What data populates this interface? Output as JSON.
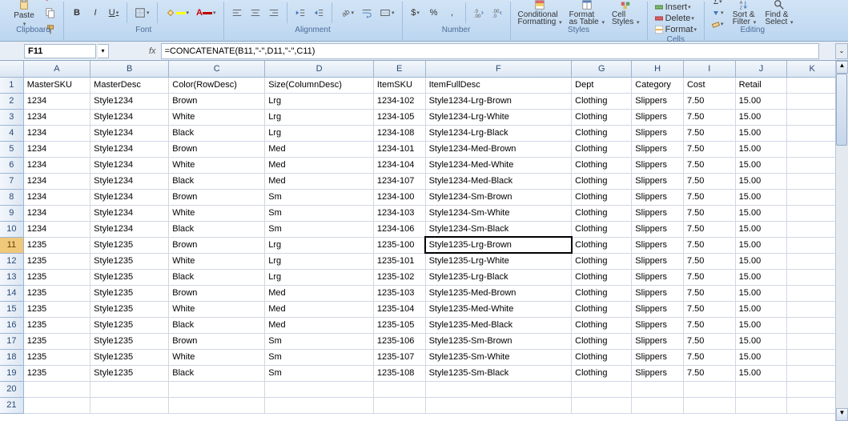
{
  "ribbon": {
    "groups": {
      "clipboard": {
        "label": "Clipboard",
        "paste": "Paste"
      },
      "font": {
        "label": "Font",
        "bold": "B",
        "italic": "I",
        "underline": "U"
      },
      "alignment": {
        "label": "Alignment"
      },
      "number": {
        "label": "Number",
        "currency": "$",
        "percent": "%",
        "comma": ","
      },
      "styles": {
        "label": "Styles",
        "conditional": "Conditional",
        "conditional2": "Formatting",
        "format_table": "Format",
        "format_table2": "as Table",
        "cell_styles": "Cell",
        "cell_styles2": "Styles"
      },
      "cells": {
        "label": "Cells",
        "insert": "Insert",
        "delete": "Delete",
        "format": "Format"
      },
      "editing": {
        "label": "Editing",
        "sort_filter": "Sort &",
        "sort_filter2": "Filter",
        "find_select": "Find &",
        "find_select2": "Select"
      }
    }
  },
  "namebox": "F11",
  "formula": "=CONCATENATE(B11,\"-\",D11,\"-\",C11)",
  "chart_data": {
    "type": "table",
    "columns": [
      "MasterSKU",
      "MasterDesc",
      "Color(RowDesc)",
      "Size(ColumnDesc)",
      "ItemSKU",
      "ItemFullDesc",
      "Dept",
      "Category",
      "Cost",
      "Retail"
    ],
    "rows": [
      {
        "MasterSKU": "1234",
        "MasterDesc": "Style1234",
        "Color": "Brown",
        "Size": "Lrg",
        "ItemSKU": "1234-102",
        "ItemFullDesc": "Style1234-Lrg-Brown",
        "Dept": "Clothing",
        "Category": "Slippers",
        "Cost": "7.50",
        "Retail": "15.00"
      },
      {
        "MasterSKU": "1234",
        "MasterDesc": "Style1234",
        "Color": "White",
        "Size": "Lrg",
        "ItemSKU": "1234-105",
        "ItemFullDesc": "Style1234-Lrg-White",
        "Dept": "Clothing",
        "Category": "Slippers",
        "Cost": "7.50",
        "Retail": "15.00"
      },
      {
        "MasterSKU": "1234",
        "MasterDesc": "Style1234",
        "Color": "Black",
        "Size": "Lrg",
        "ItemSKU": "1234-108",
        "ItemFullDesc": "Style1234-Lrg-Black",
        "Dept": "Clothing",
        "Category": "Slippers",
        "Cost": "7.50",
        "Retail": "15.00"
      },
      {
        "MasterSKU": "1234",
        "MasterDesc": "Style1234",
        "Color": "Brown",
        "Size": "Med",
        "ItemSKU": "1234-101",
        "ItemFullDesc": "Style1234-Med-Brown",
        "Dept": "Clothing",
        "Category": "Slippers",
        "Cost": "7.50",
        "Retail": "15.00"
      },
      {
        "MasterSKU": "1234",
        "MasterDesc": "Style1234",
        "Color": "White",
        "Size": "Med",
        "ItemSKU": "1234-104",
        "ItemFullDesc": "Style1234-Med-White",
        "Dept": "Clothing",
        "Category": "Slippers",
        "Cost": "7.50",
        "Retail": "15.00"
      },
      {
        "MasterSKU": "1234",
        "MasterDesc": "Style1234",
        "Color": "Black",
        "Size": "Med",
        "ItemSKU": "1234-107",
        "ItemFullDesc": "Style1234-Med-Black",
        "Dept": "Clothing",
        "Category": "Slippers",
        "Cost": "7.50",
        "Retail": "15.00"
      },
      {
        "MasterSKU": "1234",
        "MasterDesc": "Style1234",
        "Color": "Brown",
        "Size": "Sm",
        "ItemSKU": "1234-100",
        "ItemFullDesc": "Style1234-Sm-Brown",
        "Dept": "Clothing",
        "Category": "Slippers",
        "Cost": "7.50",
        "Retail": "15.00"
      },
      {
        "MasterSKU": "1234",
        "MasterDesc": "Style1234",
        "Color": "White",
        "Size": "Sm",
        "ItemSKU": "1234-103",
        "ItemFullDesc": "Style1234-Sm-White",
        "Dept": "Clothing",
        "Category": "Slippers",
        "Cost": "7.50",
        "Retail": "15.00"
      },
      {
        "MasterSKU": "1234",
        "MasterDesc": "Style1234",
        "Color": "Black",
        "Size": "Sm",
        "ItemSKU": "1234-106",
        "ItemFullDesc": "Style1234-Sm-Black",
        "Dept": "Clothing",
        "Category": "Slippers",
        "Cost": "7.50",
        "Retail": "15.00"
      },
      {
        "MasterSKU": "1235",
        "MasterDesc": "Style1235",
        "Color": "Brown",
        "Size": "Lrg",
        "ItemSKU": "1235-100",
        "ItemFullDesc": "Style1235-Lrg-Brown",
        "Dept": "Clothing",
        "Category": "Slippers",
        "Cost": "7.50",
        "Retail": "15.00"
      },
      {
        "MasterSKU": "1235",
        "MasterDesc": "Style1235",
        "Color": "White",
        "Size": "Lrg",
        "ItemSKU": "1235-101",
        "ItemFullDesc": "Style1235-Lrg-White",
        "Dept": "Clothing",
        "Category": "Slippers",
        "Cost": "7.50",
        "Retail": "15.00"
      },
      {
        "MasterSKU": "1235",
        "MasterDesc": "Style1235",
        "Color": "Black",
        "Size": "Lrg",
        "ItemSKU": "1235-102",
        "ItemFullDesc": "Style1235-Lrg-Black",
        "Dept": "Clothing",
        "Category": "Slippers",
        "Cost": "7.50",
        "Retail": "15.00"
      },
      {
        "MasterSKU": "1235",
        "MasterDesc": "Style1235",
        "Color": "Brown",
        "Size": "Med",
        "ItemSKU": "1235-103",
        "ItemFullDesc": "Style1235-Med-Brown",
        "Dept": "Clothing",
        "Category": "Slippers",
        "Cost": "7.50",
        "Retail": "15.00"
      },
      {
        "MasterSKU": "1235",
        "MasterDesc": "Style1235",
        "Color": "White",
        "Size": "Med",
        "ItemSKU": "1235-104",
        "ItemFullDesc": "Style1235-Med-White",
        "Dept": "Clothing",
        "Category": "Slippers",
        "Cost": "7.50",
        "Retail": "15.00"
      },
      {
        "MasterSKU": "1235",
        "MasterDesc": "Style1235",
        "Color": "Black",
        "Size": "Med",
        "ItemSKU": "1235-105",
        "ItemFullDesc": "Style1235-Med-Black",
        "Dept": "Clothing",
        "Category": "Slippers",
        "Cost": "7.50",
        "Retail": "15.00"
      },
      {
        "MasterSKU": "1235",
        "MasterDesc": "Style1235",
        "Color": "Brown",
        "Size": "Sm",
        "ItemSKU": "1235-106",
        "ItemFullDesc": "Style1235-Sm-Brown",
        "Dept": "Clothing",
        "Category": "Slippers",
        "Cost": "7.50",
        "Retail": "15.00"
      },
      {
        "MasterSKU": "1235",
        "MasterDesc": "Style1235",
        "Color": "White",
        "Size": "Sm",
        "ItemSKU": "1235-107",
        "ItemFullDesc": "Style1235-Sm-White",
        "Dept": "Clothing",
        "Category": "Slippers",
        "Cost": "7.50",
        "Retail": "15.00"
      },
      {
        "MasterSKU": "1235",
        "MasterDesc": "Style1235",
        "Color": "Black",
        "Size": "Sm",
        "ItemSKU": "1235-108",
        "ItemFullDesc": "Style1235-Sm-Black",
        "Dept": "Clothing",
        "Category": "Slippers",
        "Cost": "7.50",
        "Retail": "15.00"
      }
    ]
  },
  "col_letters": [
    "A",
    "B",
    "C",
    "D",
    "E",
    "F",
    "G",
    "H",
    "I",
    "J",
    "K"
  ],
  "active_cell": {
    "row": 11,
    "col": "F"
  },
  "blank_rows": [
    20,
    21
  ]
}
